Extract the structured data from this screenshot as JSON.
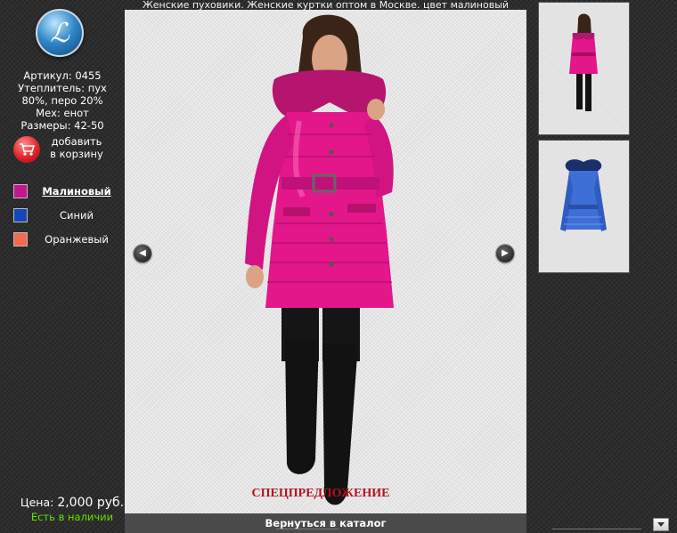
{
  "title": "Женские пуховики. Женские куртки оптом в Москве. цвет малиновый",
  "product": {
    "article": "Артикул: 0455",
    "filling_line1": "Утеплитель: пух",
    "filling_line2": "80%, перо 20%",
    "fur": "Мех: енот",
    "sizes": "Размеры: 42-50"
  },
  "cart": {
    "label_line1": "добавить",
    "label_line2": "в корзину"
  },
  "colors": [
    {
      "label": "Малиновый",
      "hex": "#c2188b",
      "active": true
    },
    {
      "label": "Синий",
      "hex": "#1448b8",
      "active": false
    },
    {
      "label": "Оранжевый",
      "hex": "#f26a4f",
      "active": false
    }
  ],
  "special_offer": "СПЕЦПРЕДЛОЖЕНИЕ",
  "back_link": "Вернуться в каталог",
  "price": {
    "label": "Цена:",
    "value": "2,000 руб."
  },
  "stock": "Есть в наличии",
  "nav": {
    "prev_icon": "chevron-left-icon",
    "next_icon": "chevron-right-icon"
  },
  "accent_colors": {
    "jacket_pink": "#e0157f",
    "jacket_blue": "#3d6fd6",
    "special_red": "#b3141e",
    "stock_green": "#66e000"
  }
}
